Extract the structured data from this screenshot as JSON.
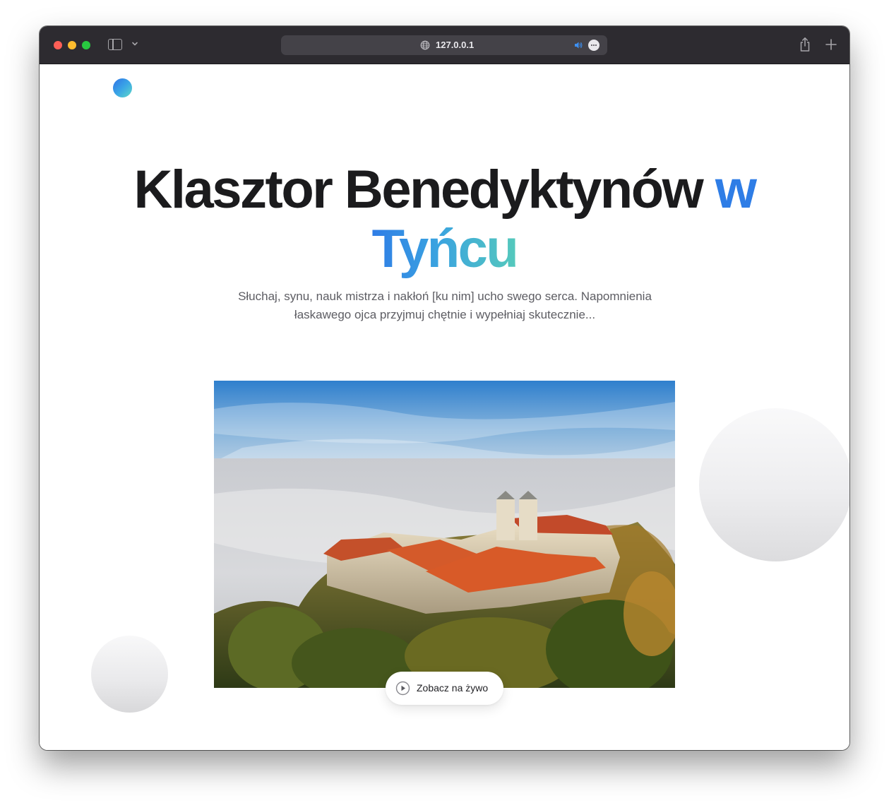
{
  "browser": {
    "url": "127.0.0.1",
    "icons": {
      "sidebar": "sidebar-toggle-icon",
      "chevron": "chevron-down-icon",
      "globe": "globe-icon",
      "audio": "speaker-icon",
      "more": "more-icon",
      "share": "share-icon",
      "new_tab": "plus-icon"
    }
  },
  "hero": {
    "title_main": "Klasztor Benedyktynów",
    "title_accent_1": "w",
    "title_accent_2": "Tyńcu",
    "subtitle": "Słuchaj, synu, nauk mistrza i nakłoń [ku nim] ucho swego serca. Napomnienia łaskawego ojca przyjmuj chętnie i wypełniaj skutecznie...",
    "live_button_label": "Zobacz na żywo",
    "image_subject": "Aerial view of Tyniec Benedictine Abbey above morning fog"
  },
  "colors": {
    "accent_blue": "#2e7de6",
    "accent_teal": "#55c9bc",
    "title_text": "#1b1b1d",
    "subtitle_text": "#5d5d63",
    "toolbar_bg": "#2d2b30"
  }
}
